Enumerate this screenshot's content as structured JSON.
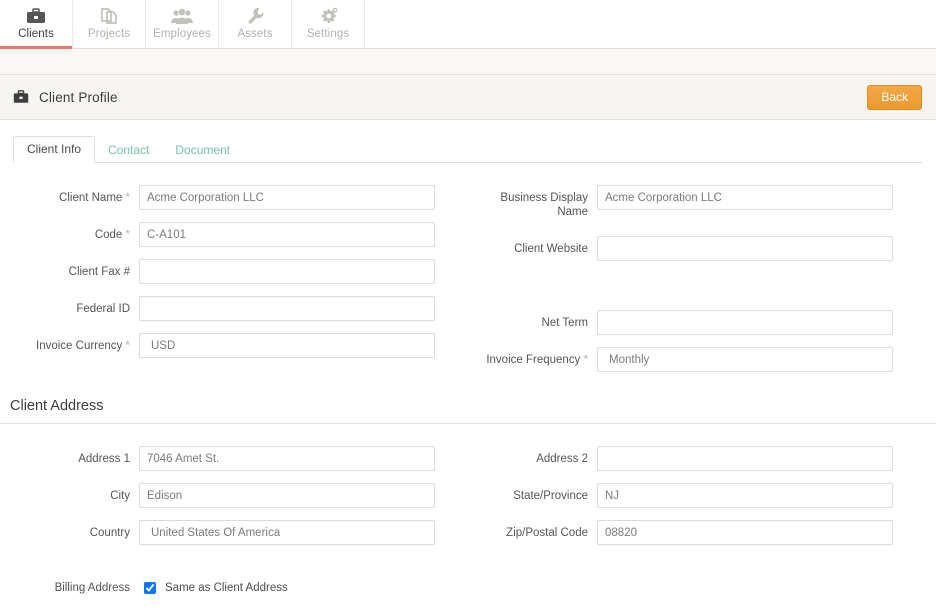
{
  "topnav": {
    "items": [
      {
        "label": "Clients",
        "icon": "briefcase-icon",
        "active": true
      },
      {
        "label": "Projects",
        "icon": "documents-icon",
        "active": false
      },
      {
        "label": "Employees",
        "icon": "people-group-icon",
        "active": false
      },
      {
        "label": "Assets",
        "icon": "wrench-icon",
        "active": false
      },
      {
        "label": "Settings",
        "icon": "gears-icon",
        "active": false
      }
    ],
    "active_indicator_color": "#e57a6a"
  },
  "page_header": {
    "icon": "briefcase-icon",
    "title": "Client Profile",
    "back_label": "Back",
    "back_color": "#f0a13c"
  },
  "tabs": [
    {
      "label": "Client Info",
      "active": true
    },
    {
      "label": "Contact",
      "active": false
    },
    {
      "label": "Document",
      "active": false
    }
  ],
  "client_info": {
    "left": [
      {
        "label": "Client Name",
        "required": true,
        "value": "Acme Corporation LLC",
        "placeholder": ""
      },
      {
        "label": "Code",
        "required": true,
        "value": "C-A101",
        "placeholder": ""
      },
      {
        "label": "Client Fax #",
        "required": false,
        "value": "",
        "placeholder": ""
      },
      {
        "label": "Federal ID",
        "required": false,
        "value": "",
        "placeholder": ""
      },
      {
        "label": "Invoice Currency",
        "required": true,
        "value": "USD",
        "placeholder": ""
      }
    ],
    "right": [
      {
        "label": "Business Display Name",
        "required": false,
        "value": "Acme Corporation LLC",
        "placeholder": ""
      },
      {
        "label": "Client Website",
        "required": false,
        "value": "",
        "placeholder": ""
      },
      {
        "label": "Net Term",
        "required": false,
        "value": "",
        "placeholder": ""
      },
      {
        "label": "Invoice Frequency",
        "required": true,
        "value": "Monthly",
        "placeholder": ""
      }
    ]
  },
  "client_address": {
    "heading": "Client Address",
    "left": [
      {
        "label": "Address 1",
        "required": false,
        "value": "7046 Amet St.",
        "placeholder": ""
      },
      {
        "label": "City",
        "required": false,
        "value": "Edison",
        "placeholder": ""
      },
      {
        "label": "Country",
        "required": false,
        "value": "United States Of America",
        "placeholder": ""
      }
    ],
    "right": [
      {
        "label": "Address 2",
        "required": false,
        "value": "",
        "placeholder": ""
      },
      {
        "label": "State/Province",
        "required": false,
        "value": "NJ",
        "placeholder": ""
      },
      {
        "label": "Zip/Postal Code",
        "required": false,
        "value": "08820",
        "placeholder": ""
      }
    ]
  },
  "billing": {
    "label": "Billing Address",
    "checkbox_label": "Same as Client Address",
    "checked": true
  }
}
